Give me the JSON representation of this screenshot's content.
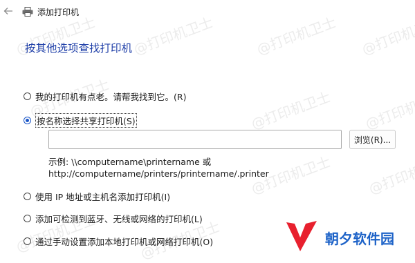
{
  "window": {
    "title": "添加打印机"
  },
  "heading": "按其他选项查找打印机",
  "options": [
    {
      "label": "我的打印机有点老。请帮我找到它。(R)",
      "checked": false
    },
    {
      "label": "按名称选择共享打印机(S)",
      "checked": true
    },
    {
      "label": "使用 IP 地址或主机名添加打印机(I)",
      "checked": false
    },
    {
      "label": "添加可检测到蓝牙、无线或网络的打印机(L)",
      "checked": false
    },
    {
      "label": "通过手动设置添加本地打印机或网络打印机(O)",
      "checked": false
    }
  ],
  "shared_printer": {
    "value": "",
    "browse_label": "浏览(R)...",
    "example_line1": "示例: \\\\computername\\printername 或",
    "example_line2": "http://computername/printers/printername/.printer"
  },
  "watermark": "@打印机卫士",
  "brand": {
    "name": "朝夕软件园",
    "accent": "#e8202e"
  }
}
